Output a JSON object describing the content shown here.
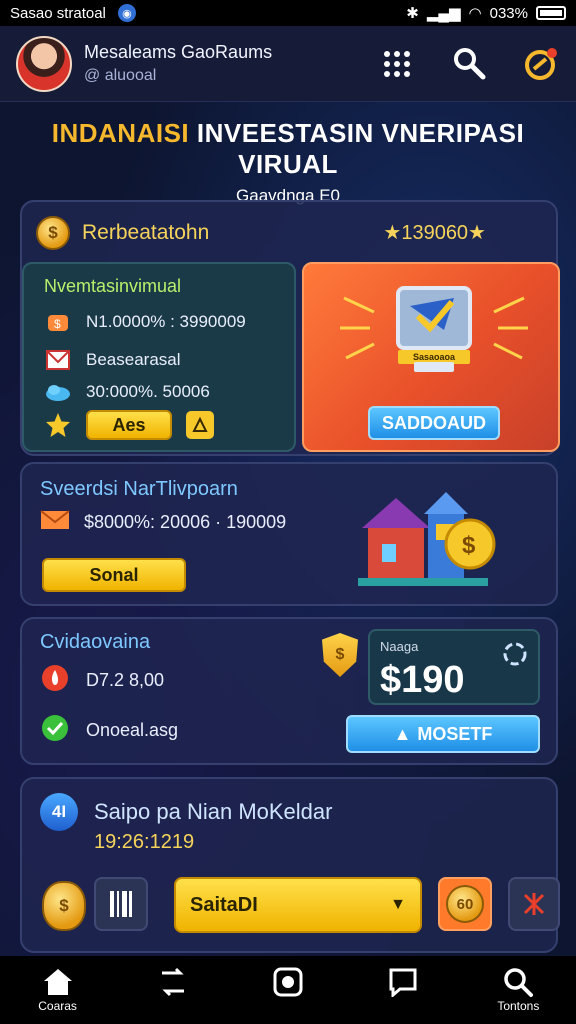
{
  "status_bar": {
    "left_text": "Sasao stratoal",
    "battery": "033%"
  },
  "header": {
    "user_name": "Mesaleams GaoRaums",
    "user_handle": "@ aluooal"
  },
  "title": {
    "accent": "INDANAISI",
    "rest": " INVEESTASIN VNERIPASI VIRUAL",
    "subtitle": "Gaavdnga E0"
  },
  "card1": {
    "label": "Rerbeatatohn",
    "score": "★139060★",
    "panel_title": "Nvemtasinvimual",
    "row1": "N1.0000% : 3990009",
    "row2": "Beasearasal",
    "row3": "30:000%. 50006",
    "small_button": "Aes",
    "screen_label": "Sasaoaoa",
    "action_button": "SADDOAUD"
  },
  "card2": {
    "title": "Sveerdsi NarTlivpoarn",
    "row": "$8000%: 20006 · 190009",
    "button": "Sonal"
  },
  "card3": {
    "title": "Cvidaovaina",
    "row1": "D7.2 8,00",
    "row2": "Onoeal.asg",
    "shield_glyph": "$",
    "price_small": "Naaga",
    "price_big": "$190",
    "button": "MOSETF"
  },
  "card4": {
    "badge": "4I",
    "title": "Saipo pa Nian MoKeldar",
    "date": "19:26:1219",
    "select_value": "SaitaDI",
    "coin_glyph": "$",
    "badge_60": "60"
  },
  "bottom_nav": {
    "items": [
      {
        "label": "Coaras",
        "icon": "home-icon"
      },
      {
        "label": "",
        "icon": "swap-icon"
      },
      {
        "label": "",
        "icon": "record-icon"
      },
      {
        "label": "",
        "icon": "chat-icon"
      },
      {
        "label": "Tontons",
        "icon": "search-icon"
      }
    ]
  },
  "colors": {
    "accent_gold": "#f6b82c",
    "accent_blue": "#1f8fe6",
    "orange_panel": "#e8502a",
    "background": "#0d1530"
  }
}
